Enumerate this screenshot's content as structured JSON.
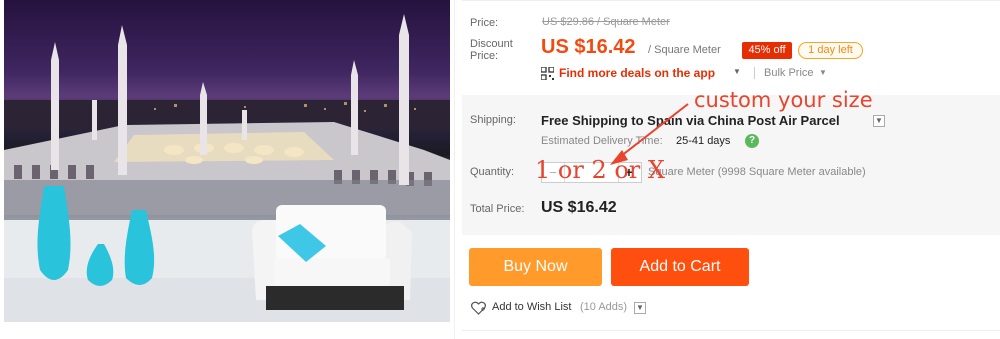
{
  "product_image": {
    "alt_name": "mosque-wall-mural-photo"
  },
  "pricing": {
    "price_label": "Price:",
    "original_price": "US $29.86 / Square Meter",
    "discount_label_line1": "Discount",
    "discount_label_line2": "Price:",
    "current_price": "US $16.42",
    "unit": "/ Square Meter",
    "discount_badge": "45% off",
    "time_badge": "1 day left",
    "deals_link": "Find more deals on the app",
    "bulk_price": "Bulk Price"
  },
  "shipping": {
    "label": "Shipping:",
    "method": "Free Shipping to Spain via China Post Air Parcel",
    "estimate_label": "Estimated Delivery Time:",
    "estimate_value": "25-41 days"
  },
  "quantity": {
    "label": "Quantity:",
    "minus": "−",
    "plus": "+",
    "availability": "Square Meter (9998 Square Meter available)"
  },
  "total": {
    "label": "Total Price:",
    "value": "US $16.42"
  },
  "actions": {
    "buy_now": "Buy Now",
    "add_to_cart": "Add to Cart",
    "wish_list": "Add to Wish List",
    "wish_count": "(10 Adds)"
  },
  "annotations": {
    "line1": "custom your size",
    "line2": "1 or 2 or X"
  },
  "colors": {
    "price": "#f34b0f",
    "buy_now": "#ff9a2b",
    "add_to_cart": "#ff4f0f",
    "annotation": "#e8442e"
  }
}
